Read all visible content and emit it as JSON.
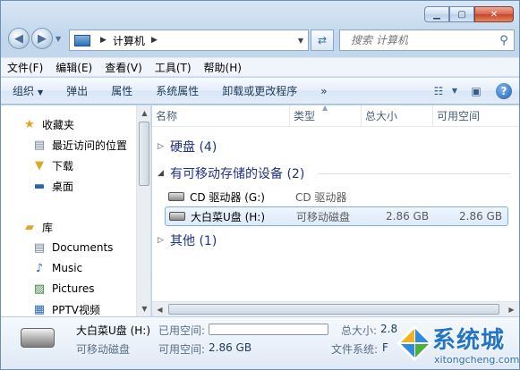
{
  "address": {
    "crumbs": [
      "计算机"
    ]
  },
  "search": {
    "placeholder": "搜索 计算机"
  },
  "menu": [
    "文件(F)",
    "编辑(E)",
    "查看(V)",
    "工具(T)",
    "帮助(H)"
  ],
  "toolbar": {
    "organize": "组织",
    "eject": "弹出",
    "properties": "属性",
    "system_properties": "系统属性",
    "uninstall": "卸载或更改程序",
    "more": "»"
  },
  "sidebar": {
    "favorites": "收藏夹",
    "items": [
      "最近访问的位置",
      "下载",
      "桌面"
    ],
    "library": "库",
    "lib_items": [
      "Documents",
      "Music",
      "Pictures",
      "PPTV视频"
    ]
  },
  "columns": [
    "名称",
    "类型",
    "总大小",
    "可用空间"
  ],
  "groups": {
    "hard_disk": "硬盘 (4)",
    "removable": "有可移动存储的设备 (2)",
    "other": "其他 (1)"
  },
  "rows": [
    {
      "name": "CD 驱动器 (G:)",
      "type": "CD 驱动器",
      "total": "",
      "free": ""
    },
    {
      "name": "大白菜U盘 (H:)",
      "type": "可移动磁盘",
      "total": "2.86 GB",
      "free": "2.86 GB"
    }
  ],
  "details": {
    "name": "大白菜U盘 (H:)",
    "kind": "可移动磁盘",
    "used_label": "已用空间:",
    "free_label": "可用空间:",
    "free_value": "2.86 GB",
    "total_label": "总大小:",
    "total_value": "2.8",
    "fs_label": "文件系统:",
    "fs_value": "F",
    "used_fraction": 0.0
  },
  "watermark": {
    "brand": "系统城",
    "site": "xitongcheng.com"
  },
  "colors": {
    "accent": "#2475c5",
    "selection": "#84acdd",
    "group_text": "#1e3287"
  }
}
